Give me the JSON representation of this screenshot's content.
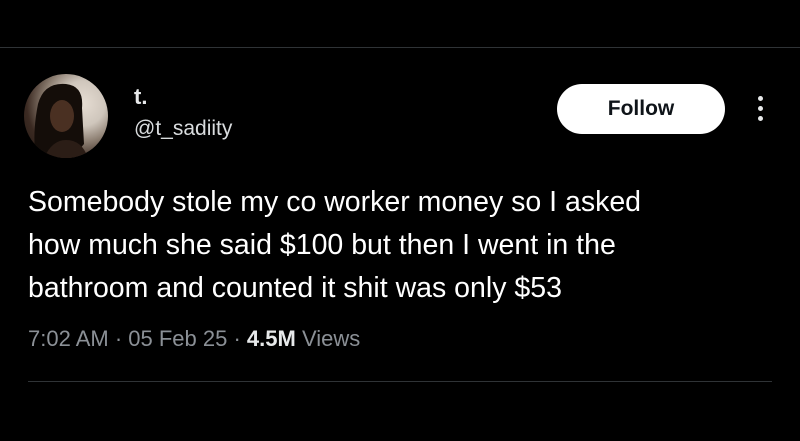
{
  "author": {
    "display_name": "t.",
    "handle": "@t_sadiity"
  },
  "actions": {
    "follow_label": "Follow",
    "more_icon": "more-vertical-icon"
  },
  "tweet": {
    "text_lines": [
      "Somebody stole my co worker money so I asked",
      "how much she said $100 but then I went in the",
      "bathroom and counted it shit was only $53"
    ]
  },
  "meta": {
    "time": "7:02 AM",
    "separator": " · ",
    "date": "05 Feb 25",
    "views_count": "4.5M",
    "views_label": "Views"
  },
  "colors": {
    "background": "#000000",
    "text_primary": "#e7e9ea",
    "text_secondary": "#8b9096",
    "button_bg": "#ffffff",
    "divider": "#2f3336"
  }
}
